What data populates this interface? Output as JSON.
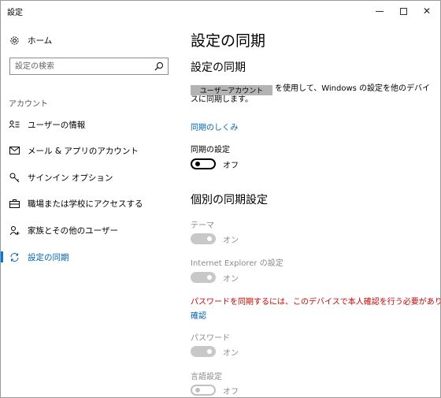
{
  "window": {
    "title": "設定"
  },
  "sidebar": {
    "home_label": "ホーム",
    "search_placeholder": "設定の検索",
    "section_header": "アカウント",
    "items": [
      {
        "label": "ユーザーの情報",
        "icon": "user-info-icon"
      },
      {
        "label": "メール & アプリのアカウント",
        "icon": "mail-icon"
      },
      {
        "label": "サインイン オプション",
        "icon": "key-icon"
      },
      {
        "label": "職場または学校にアクセスする",
        "icon": "briefcase-icon"
      },
      {
        "label": "家族とその他のユーザー",
        "icon": "person-add-icon"
      },
      {
        "label": "設定の同期",
        "icon": "sync-icon",
        "active": true
      }
    ]
  },
  "main": {
    "title": "設定の同期",
    "sync_heading": "設定の同期",
    "account_badge": "ユーザーアカウント",
    "account_text": "を使用して、Windows の設定を他のデバイスに同期します。",
    "how_link": "同期のしくみ",
    "sync_settings_label": "同期の設定",
    "sync_toggle_state": "オフ",
    "individual_heading": "個別の同期設定",
    "theme_label": "テーマ",
    "theme_state": "オン",
    "ie_label": "Internet Explorer の設定",
    "ie_state": "オン",
    "warning": "パスワードを同期するには、このデバイスで本人確認を行う必要があります。",
    "verify_link": "確認",
    "password_label": "パスワード",
    "password_state": "オン",
    "language_label": "言語設定",
    "language_state": "オフ"
  },
  "colors": {
    "accent": "#0063b1",
    "warning": "#c50500",
    "disabled": "#8a8a8a"
  }
}
